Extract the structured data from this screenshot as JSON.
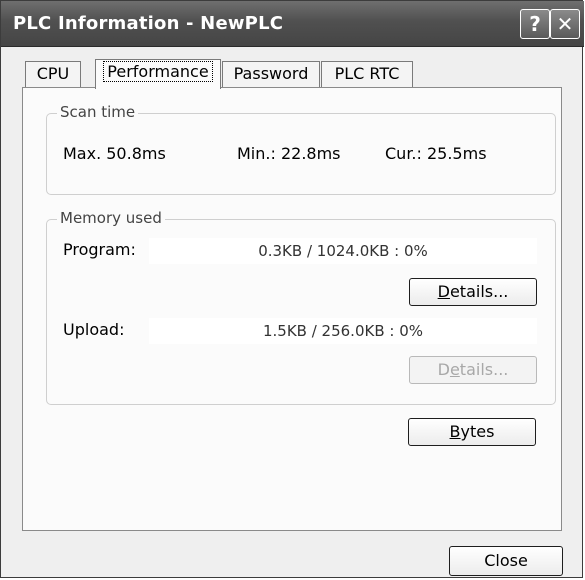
{
  "window": {
    "title": "PLC Information - NewPLC",
    "help_icon": "?",
    "close_icon": "✕"
  },
  "tabs": [
    {
      "label": "CPU",
      "active": false
    },
    {
      "label": "Performance",
      "active": true
    },
    {
      "label": "Password",
      "active": false
    },
    {
      "label": "PLC RTC",
      "active": false
    }
  ],
  "scan_time": {
    "group_label": "Scan time",
    "max": "Max.  50.8ms",
    "min": "Min.:  22.8ms",
    "cur": "Cur.:  25.5ms"
  },
  "memory_used": {
    "group_label": "Memory used",
    "program_label": "Program:",
    "program_value": "0.3KB / 1024.0KB : 0%",
    "upload_label": "Upload:",
    "upload_value": "1.5KB / 256.0KB : 0%",
    "details_label_mnemonic": "D",
    "details_label_rest": "etails...",
    "details2_pre": "D",
    "details2_mnemonic": "e",
    "details2_rest": "tails..."
  },
  "buttons": {
    "bytes_mnemonic": "B",
    "bytes_rest": "ytes",
    "close": "Close"
  },
  "colors": {
    "titlebar": "#505050",
    "window_bg": "#efefef",
    "panel_bg": "#fbfbfb"
  }
}
